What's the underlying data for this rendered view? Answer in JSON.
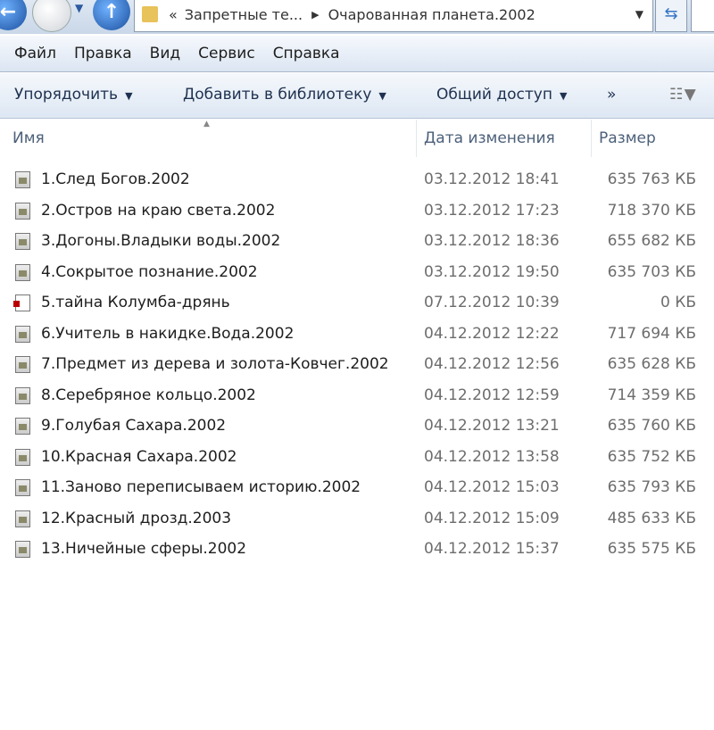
{
  "address": {
    "overflow": "«",
    "parent": "Запретные те...",
    "current": "Очарованная планета.2002"
  },
  "menu": [
    "Файл",
    "Правка",
    "Вид",
    "Сервис",
    "Справка"
  ],
  "toolbar": {
    "organize": "Упорядочить",
    "add_library": "Добавить в библиотеку",
    "share": "Общий доступ",
    "more": "»"
  },
  "columns": {
    "name": "Имя",
    "date": "Дата изменения",
    "size": "Размер"
  },
  "files": [
    {
      "name": "1.След Богов.2002",
      "date": "03.12.2012 18:41",
      "size": "635 763 КБ",
      "icon": "video-file-icon"
    },
    {
      "name": "2.Остров на краю света.2002",
      "date": "03.12.2012 17:23",
      "size": "718 370 КБ",
      "icon": "video-file-icon"
    },
    {
      "name": "3.Догоны.Владыки воды.2002",
      "date": "03.12.2012 18:36",
      "size": "655 682 КБ",
      "icon": "video-file-icon"
    },
    {
      "name": "4.Сокрытое познание.2002",
      "date": "03.12.2012 19:50",
      "size": "635 703 КБ",
      "icon": "video-file-icon"
    },
    {
      "name": "5.тайна Колумба-дрянь",
      "date": "07.12.2012 10:39",
      "size": "0 КБ",
      "icon": "blank-file-icon"
    },
    {
      "name": "6.Учитель в накидке.Вода.2002",
      "date": "04.12.2012 12:22",
      "size": "717 694 КБ",
      "icon": "video-file-icon"
    },
    {
      "name": "7.Предмет из дерева и золота-Ковчег.2002",
      "date": "04.12.2012 12:56",
      "size": "635 628 КБ",
      "icon": "video-file-icon"
    },
    {
      "name": "8.Серебряное кольцо.2002",
      "date": "04.12.2012 12:59",
      "size": "714 359 КБ",
      "icon": "video-file-icon"
    },
    {
      "name": "9.Голубая Сахара.2002",
      "date": "04.12.2012 13:21",
      "size": "635 760 КБ",
      "icon": "video-file-icon"
    },
    {
      "name": "10.Красная Сахара.2002",
      "date": "04.12.2012 13:58",
      "size": "635 752 КБ",
      "icon": "video-file-icon"
    },
    {
      "name": "11.Заново переписываем историю.2002",
      "date": "04.12.2012 15:03",
      "size": "635 793 КБ",
      "icon": "video-file-icon"
    },
    {
      "name": "12.Красный дрозд.2003",
      "date": "04.12.2012 15:09",
      "size": "485 633 КБ",
      "icon": "video-file-icon"
    },
    {
      "name": "13.Ничейные сферы.2002",
      "date": "04.12.2012 15:37",
      "size": "635 575 КБ",
      "icon": "video-file-icon"
    }
  ]
}
